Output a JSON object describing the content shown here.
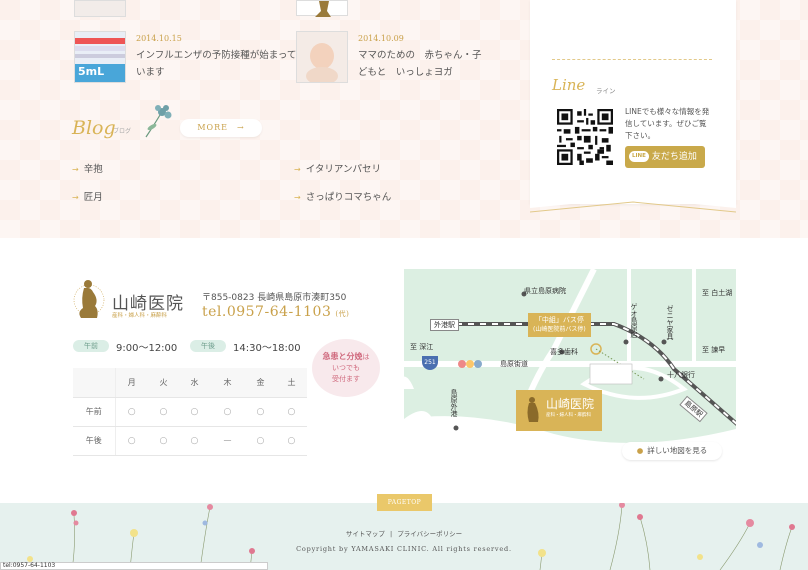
{
  "news": [
    {
      "date": "2014.10.15",
      "text": "インフルエンザの予防接種が始まっています",
      "thumb_label": "5mL"
    },
    {
      "date": "2014.10.09",
      "text": "ママのための　赤ちゃん・子どもと　いっしょヨガ"
    }
  ],
  "blog": {
    "title": "Blog",
    "subtitle": "ブログ",
    "more": "MORE　→",
    "items": [
      "辛抱",
      "イタリアンパセリ",
      "匠月",
      "さっぱりコマちゃん"
    ],
    "arrow": "→"
  },
  "line": {
    "title": "Line",
    "subtitle": "ライン",
    "description": "LINEでも様々な情報を発信しています。ぜひご覧下さい。",
    "button_badge": "LINE",
    "button_label": "友だち追加"
  },
  "clinic": {
    "name": "山崎医院",
    "departments": "産科・婦人科・麻酔科",
    "address": "〒855-0823 長崎県島原市湊町350",
    "tel": "tel.0957-64-1103",
    "tel_note": "(代)"
  },
  "hours": [
    {
      "label": "午前",
      "time": "9:00〜12:00"
    },
    {
      "label": "午後",
      "time": "14:30〜18:00"
    }
  ],
  "urgent": {
    "line1": "急患と分娩",
    "line1b": "は",
    "line2": "いつでも",
    "line3": "受付ます"
  },
  "schedule": {
    "days": [
      "月",
      "火",
      "水",
      "木",
      "金",
      "土"
    ],
    "rows": [
      {
        "label": "午前",
        "cells": [
          "○",
          "○",
          "○",
          "○",
          "○",
          "○"
        ]
      },
      {
        "label": "午後",
        "cells": [
          "○",
          "○",
          "○",
          "ー",
          "○",
          "○"
        ]
      }
    ]
  },
  "map": {
    "labels": {
      "hospital": "県立島原病院",
      "shiratsuchi": "至 白土湖",
      "gaisoeki": "外港駅",
      "bus_stop": "「中組」バス停",
      "bus_stop_sub": "(山崎医院前バス停)",
      "fukae": "至 深江",
      "dental": "喜多歯科",
      "shimabara_kaido": "島原街道",
      "route": "251",
      "gaikou": "島原外港",
      "juhachi": "十八銀行",
      "isahaya": "至 諫早",
      "shimabara_eki": "島原駅",
      "zeniya": "ゼニヤ家具",
      "pharmacy": "ゲオ島原店",
      "clinic_name": "山崎医院",
      "clinic_dept": "産科・婦人科・麻酔科"
    },
    "detail_button": "詳しい地図を見る"
  },
  "footer": {
    "pagetop": "PAGETOP",
    "sitemap": "サイトマップ",
    "separator": "|",
    "privacy": "プライバシーポリシー",
    "copyright": "Copyright by YAMASAKI CLINIC. All rights reserved."
  },
  "status_bar": "tel:0957-64-1103",
  "colors": {
    "gold": "#c9a14a",
    "mint": "#dcefe2",
    "pink": "#fcf1ec",
    "line_green": "#c9a94a"
  }
}
